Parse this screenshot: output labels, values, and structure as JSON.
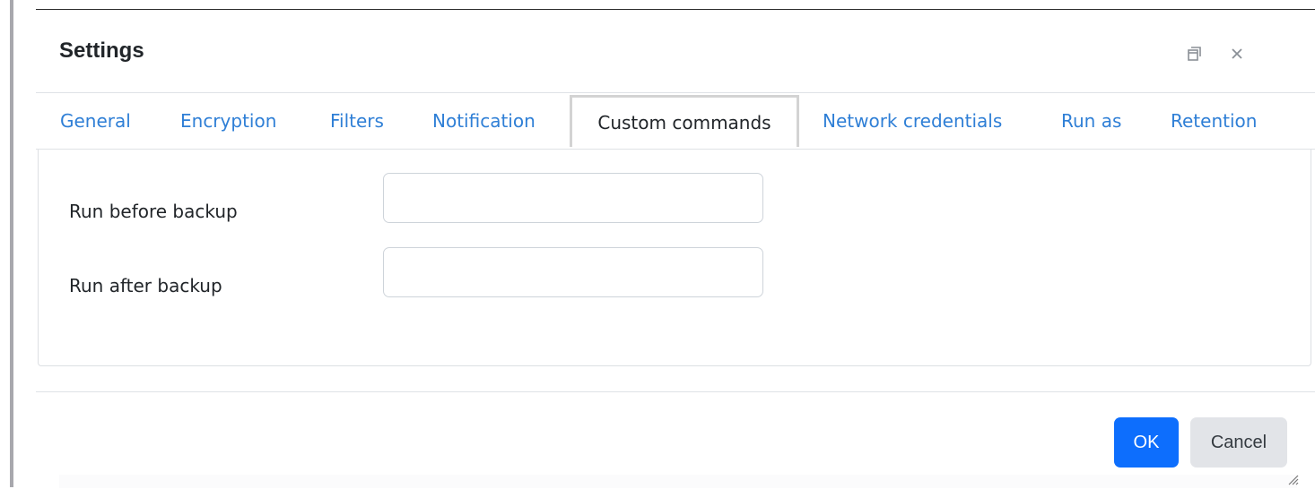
{
  "dialog": {
    "title": "Settings",
    "maximize_icon": "restore-window-icon",
    "close_icon": "close-icon",
    "close_glyph": "×"
  },
  "tabs": [
    {
      "label": "General",
      "active": false
    },
    {
      "label": "Encryption",
      "active": false
    },
    {
      "label": "Filters",
      "active": false
    },
    {
      "label": "Notification",
      "active": false
    },
    {
      "label": "Custom commands",
      "active": true
    },
    {
      "label": "Network credentials",
      "active": false
    },
    {
      "label": "Run as",
      "active": false
    },
    {
      "label": "Retention",
      "active": false
    }
  ],
  "form": {
    "run_before_label": "Run before backup",
    "run_before_value": "",
    "run_after_label": "Run after backup",
    "run_after_value": ""
  },
  "footer": {
    "ok_label": "OK",
    "cancel_label": "Cancel"
  },
  "colors": {
    "tab_link": "#2f7fd6",
    "primary_button": "#0d6efd",
    "secondary_button": "#e2e4e8",
    "active_tab_border": "#d3d3d3"
  }
}
